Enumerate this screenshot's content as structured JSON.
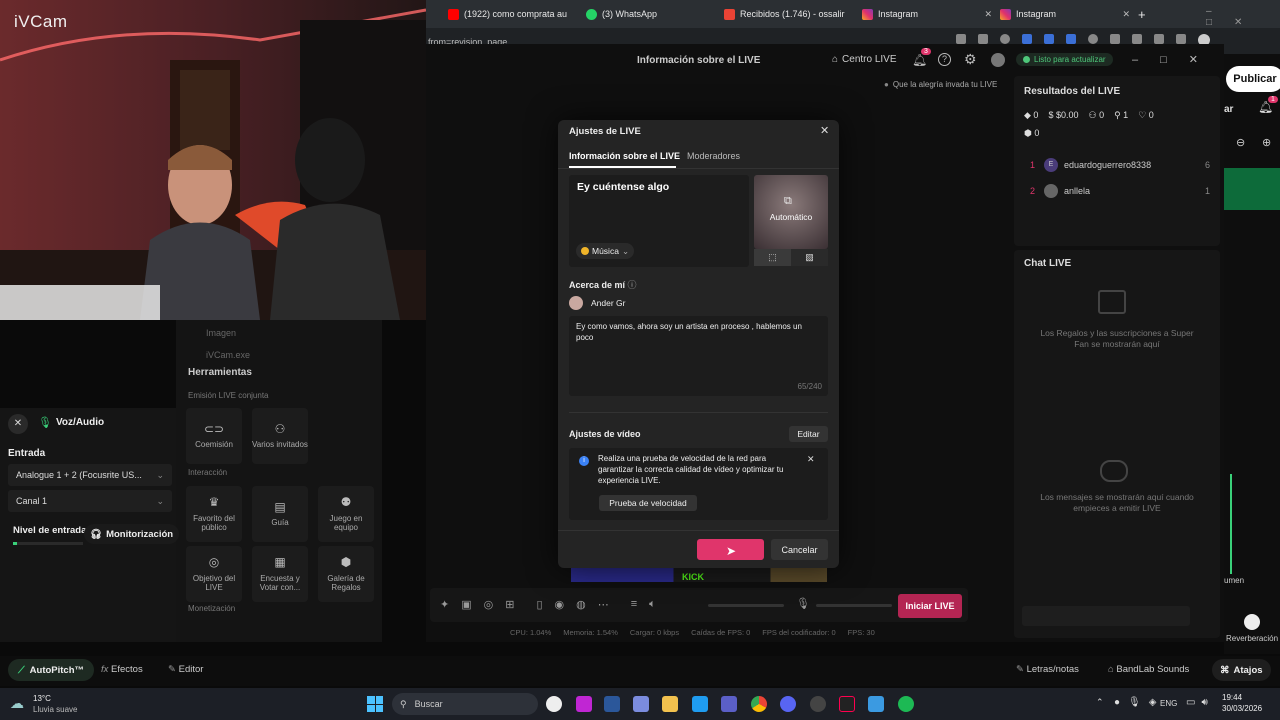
{
  "webcam": {
    "app_label": "iVCam"
  },
  "browser": {
    "tabs": [
      {
        "label": "(1922) como comprata au",
        "icon_color": "#ff0000",
        "icon": "youtube-icon"
      },
      {
        "label": "(3) WhatsApp",
        "icon_color": "#25d366",
        "icon": "whatsapp-icon"
      },
      {
        "label": "Recibidos (1.746) - ossalir",
        "icon_color": "#ea4335",
        "icon": "gmail-icon"
      },
      {
        "label": "Instagram",
        "icon_color": "#e1306c",
        "icon": "instagram-icon"
      },
      {
        "label": "Instagram",
        "icon_color": "#e1306c",
        "icon": "instagram-icon"
      }
    ],
    "new_tab": "+",
    "url_fragment": "from=revision_page"
  },
  "live_studio": {
    "title": "Información sobre el LIVE",
    "centro_live": "Centro LIVE",
    "notif_count": "3",
    "status": "Listo para actualizar",
    "topic": "Que la alegría invada tu LIVE",
    "publish_label": "Publicar",
    "badge_count": "1",
    "results": {
      "title": "Resultados del LIVE",
      "stats": [
        "0",
        "$0.00",
        "0",
        "1",
        "0"
      ],
      "stat2": "0",
      "ranking": [
        {
          "rank": "1",
          "avatar": "E",
          "name": "eduardoguerrero8338",
          "score": "6",
          "avatar_color": "#4a3c7a"
        },
        {
          "rank": "2",
          "avatar": "",
          "name": "anllela",
          "score": "1",
          "avatar_color": "#666"
        }
      ]
    },
    "chat": {
      "title": "Chat LIVE",
      "gifts_note": "Los Regalos y las suscripciones a Super Fan se mostrarán aquí",
      "messages_note": "Los mensajes se mostrarán aquí cuando empieces a emitir LIVE"
    },
    "sources": {
      "item1": "Imagen",
      "item2": "iVCam.exe"
    },
    "tools": {
      "title": "Herramientas",
      "section1": "Emisión LIVE conjunta",
      "coemision": "Coemisión",
      "varios": "Varios invitados",
      "section2": "Interacción",
      "favorito": "Favorito del público",
      "guia": "Guía",
      "juego": "Juego en equipo",
      "objetivo": "Objetivo del LIVE",
      "encuesta": "Encuesta y Votar con...",
      "galeria": "Galería de Regalos",
      "section3": "Monetización"
    },
    "start_button": "Iniciar LIVE",
    "footer_stats": {
      "cpu": "CPU: 1.04%",
      "mem": "Memoria: 1.54%",
      "load": "Cargar: 0 kbps",
      "fps_drop": "Caídas de FPS: 0",
      "enc_fps": "FPS del codificador: 0",
      "fps": "FPS: 30"
    },
    "kick_label": "KICK"
  },
  "modal": {
    "title": "Ajustes de LIVE",
    "tab_info": "Información sobre el LIVE",
    "tab_mods": "Moderadores",
    "live_title": "Ey cuéntense algo",
    "category": "Música",
    "cover_label": "Automático",
    "about_label": "Acerca de mí",
    "username": "Ander Gr",
    "bio": "Ey como vamos, ahora soy un artista en proceso , hablemos un poco",
    "char_count": "65/240",
    "video_settings": "Ajustes de vídeo",
    "edit": "Editar",
    "speed_note": "Realiza una prueba de velocidad de la red para garantizar la correcta calidad de vídeo y optimizar tu experiencia LIVE.",
    "speed_test": "Prueba de velocidad",
    "confirm": "",
    "cancel": "Cancelar",
    "accent": "#e0356b"
  },
  "bandlab": {
    "voice_title": "Voz/Audio",
    "input_label": "Entrada",
    "input_value": "Analogue 1 + 2 (Focusrite US...",
    "channel_value": "Canal 1",
    "level_label": "Nivel de entrada",
    "monitor_label": "Monitorización",
    "volume_label": "umen",
    "reverb_label": "Reverberación",
    "autopitch": "AutoPitch™",
    "effects": "Efectos",
    "editor": "Editor",
    "lyrics": "Letras/notas",
    "sounds": "BandLab Sounds",
    "shortcuts": "Atajos",
    "share_label": "ar"
  },
  "taskbar": {
    "weather_temp": "13°C",
    "weather_desc": "Lluvia suave",
    "search": "Buscar",
    "lang": "ENG",
    "time": "19:44",
    "date": "30/03/2026"
  }
}
